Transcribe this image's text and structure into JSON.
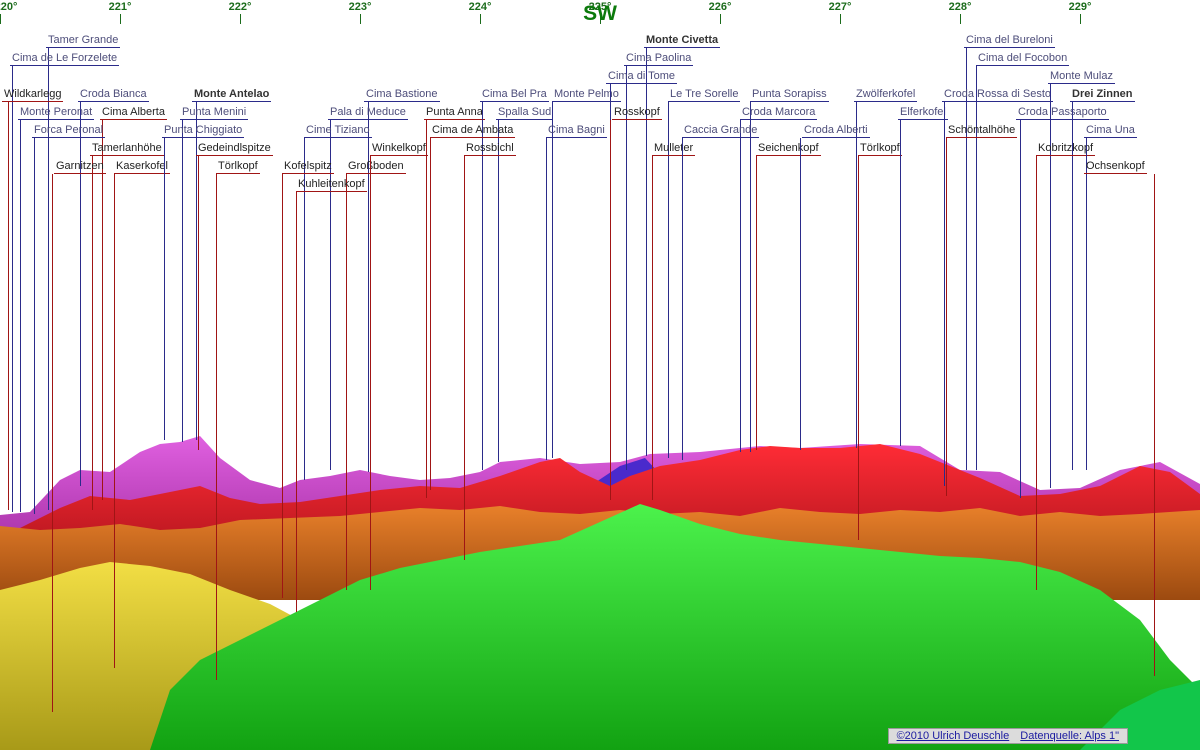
{
  "direction": "SW",
  "degrees": [
    "220°",
    "221°",
    "222°",
    "223°",
    "224°",
    "225°",
    "226°",
    "227°",
    "228°",
    "229°"
  ],
  "peaks": [
    {
      "name": "Tamer Grande",
      "color": "blue",
      "bold": false
    },
    {
      "name": "Cima de Le Forzelete",
      "color": "blue",
      "bold": false
    },
    {
      "name": "Wildkarlegg",
      "color": "red",
      "bold": false
    },
    {
      "name": "Croda Bianca",
      "color": "blue",
      "bold": false
    },
    {
      "name": "Monte Peronat",
      "color": "blue",
      "bold": false
    },
    {
      "name": "Cima Alberta",
      "color": "red",
      "bold": false
    },
    {
      "name": "Forca Peronal",
      "color": "blue",
      "bold": false
    },
    {
      "name": "Tamerlanhöhe",
      "color": "red",
      "bold": false
    },
    {
      "name": "Garnitzen",
      "color": "red",
      "bold": false
    },
    {
      "name": "Kaserkofel",
      "color": "red",
      "bold": false
    },
    {
      "name": "Monte Antelao",
      "color": "blue",
      "bold": true
    },
    {
      "name": "Punta Menini",
      "color": "blue",
      "bold": false
    },
    {
      "name": "Punta Chiggiato",
      "color": "blue",
      "bold": false
    },
    {
      "name": "Gedeindlspitze",
      "color": "red",
      "bold": false
    },
    {
      "name": "Törlkopf",
      "color": "red",
      "bold": false
    },
    {
      "name": "Cima Bastione",
      "color": "blue",
      "bold": false
    },
    {
      "name": "Pala di Meduce",
      "color": "blue",
      "bold": false
    },
    {
      "name": "Cime Tiziano",
      "color": "blue",
      "bold": false
    },
    {
      "name": "Kofelspitz",
      "color": "red",
      "bold": false
    },
    {
      "name": "Großboden",
      "color": "red",
      "bold": false
    },
    {
      "name": "Kuhleitenkopf",
      "color": "red",
      "bold": false
    },
    {
      "name": "Winkelkopf",
      "color": "red",
      "bold": false
    },
    {
      "name": "Punta Anna",
      "color": "red",
      "bold": false
    },
    {
      "name": "Cima Bel Pra",
      "color": "blue",
      "bold": false
    },
    {
      "name": "Spalla Sud",
      "color": "blue",
      "bold": false
    },
    {
      "name": "Cima de Ambata",
      "color": "red",
      "bold": false
    },
    {
      "name": "Rossbichl",
      "color": "red",
      "bold": false
    },
    {
      "name": "Monte Pelmo",
      "color": "blue",
      "bold": false
    },
    {
      "name": "Cima Bagni",
      "color": "blue",
      "bold": false
    },
    {
      "name": "Monte Civetta",
      "color": "blue",
      "bold": true
    },
    {
      "name": "Cima Paolina",
      "color": "blue",
      "bold": false
    },
    {
      "name": "Cima di Tome",
      "color": "blue",
      "bold": false
    },
    {
      "name": "Rosskopf",
      "color": "red",
      "bold": false
    },
    {
      "name": "Le Tre Sorelle",
      "color": "blue",
      "bold": false
    },
    {
      "name": "Mulleter",
      "color": "red",
      "bold": false
    },
    {
      "name": "Punta Sorapiss",
      "color": "blue",
      "bold": false
    },
    {
      "name": "Croda Marcora",
      "color": "blue",
      "bold": false
    },
    {
      "name": "Caccia Grande",
      "color": "blue",
      "bold": false
    },
    {
      "name": "Seichenkopf",
      "color": "red",
      "bold": false
    },
    {
      "name": "Zwölferkofel",
      "color": "blue",
      "bold": false
    },
    {
      "name": "Croda Alberti",
      "color": "blue",
      "bold": false
    },
    {
      "name": "Törlkopf",
      "color": "red",
      "bold": false
    },
    {
      "name": "Elferkofel",
      "color": "blue",
      "bold": false
    },
    {
      "name": "Cima del Bureloni",
      "color": "blue",
      "bold": false
    },
    {
      "name": "Cima del Focobon",
      "color": "blue",
      "bold": false
    },
    {
      "name": "Croda Rossa di Sesto",
      "color": "blue",
      "bold": false
    },
    {
      "name": "Schöntalhöhe",
      "color": "red",
      "bold": false
    },
    {
      "name": "Monte Mulaz",
      "color": "blue",
      "bold": false
    },
    {
      "name": "Drei Zinnen",
      "color": "blue",
      "bold": true
    },
    {
      "name": "Croda Passaporto",
      "color": "blue",
      "bold": false
    },
    {
      "name": "Kobritzkopf",
      "color": "red",
      "bold": false
    },
    {
      "name": "Cima Una",
      "color": "blue",
      "bold": false
    },
    {
      "name": "Ochsenkopf",
      "color": "red",
      "bold": false
    }
  ],
  "credit": {
    "author": "©2010 Ulrich Deuschle",
    "source": "Datenquelle: Alps 1\""
  },
  "layer_colors": [
    "#c8c8e0",
    "#d23ec8",
    "#d8262e",
    "#c86010",
    "#d8c21c",
    "#1ed21e",
    "#18bc18",
    "#20d84a"
  ]
}
